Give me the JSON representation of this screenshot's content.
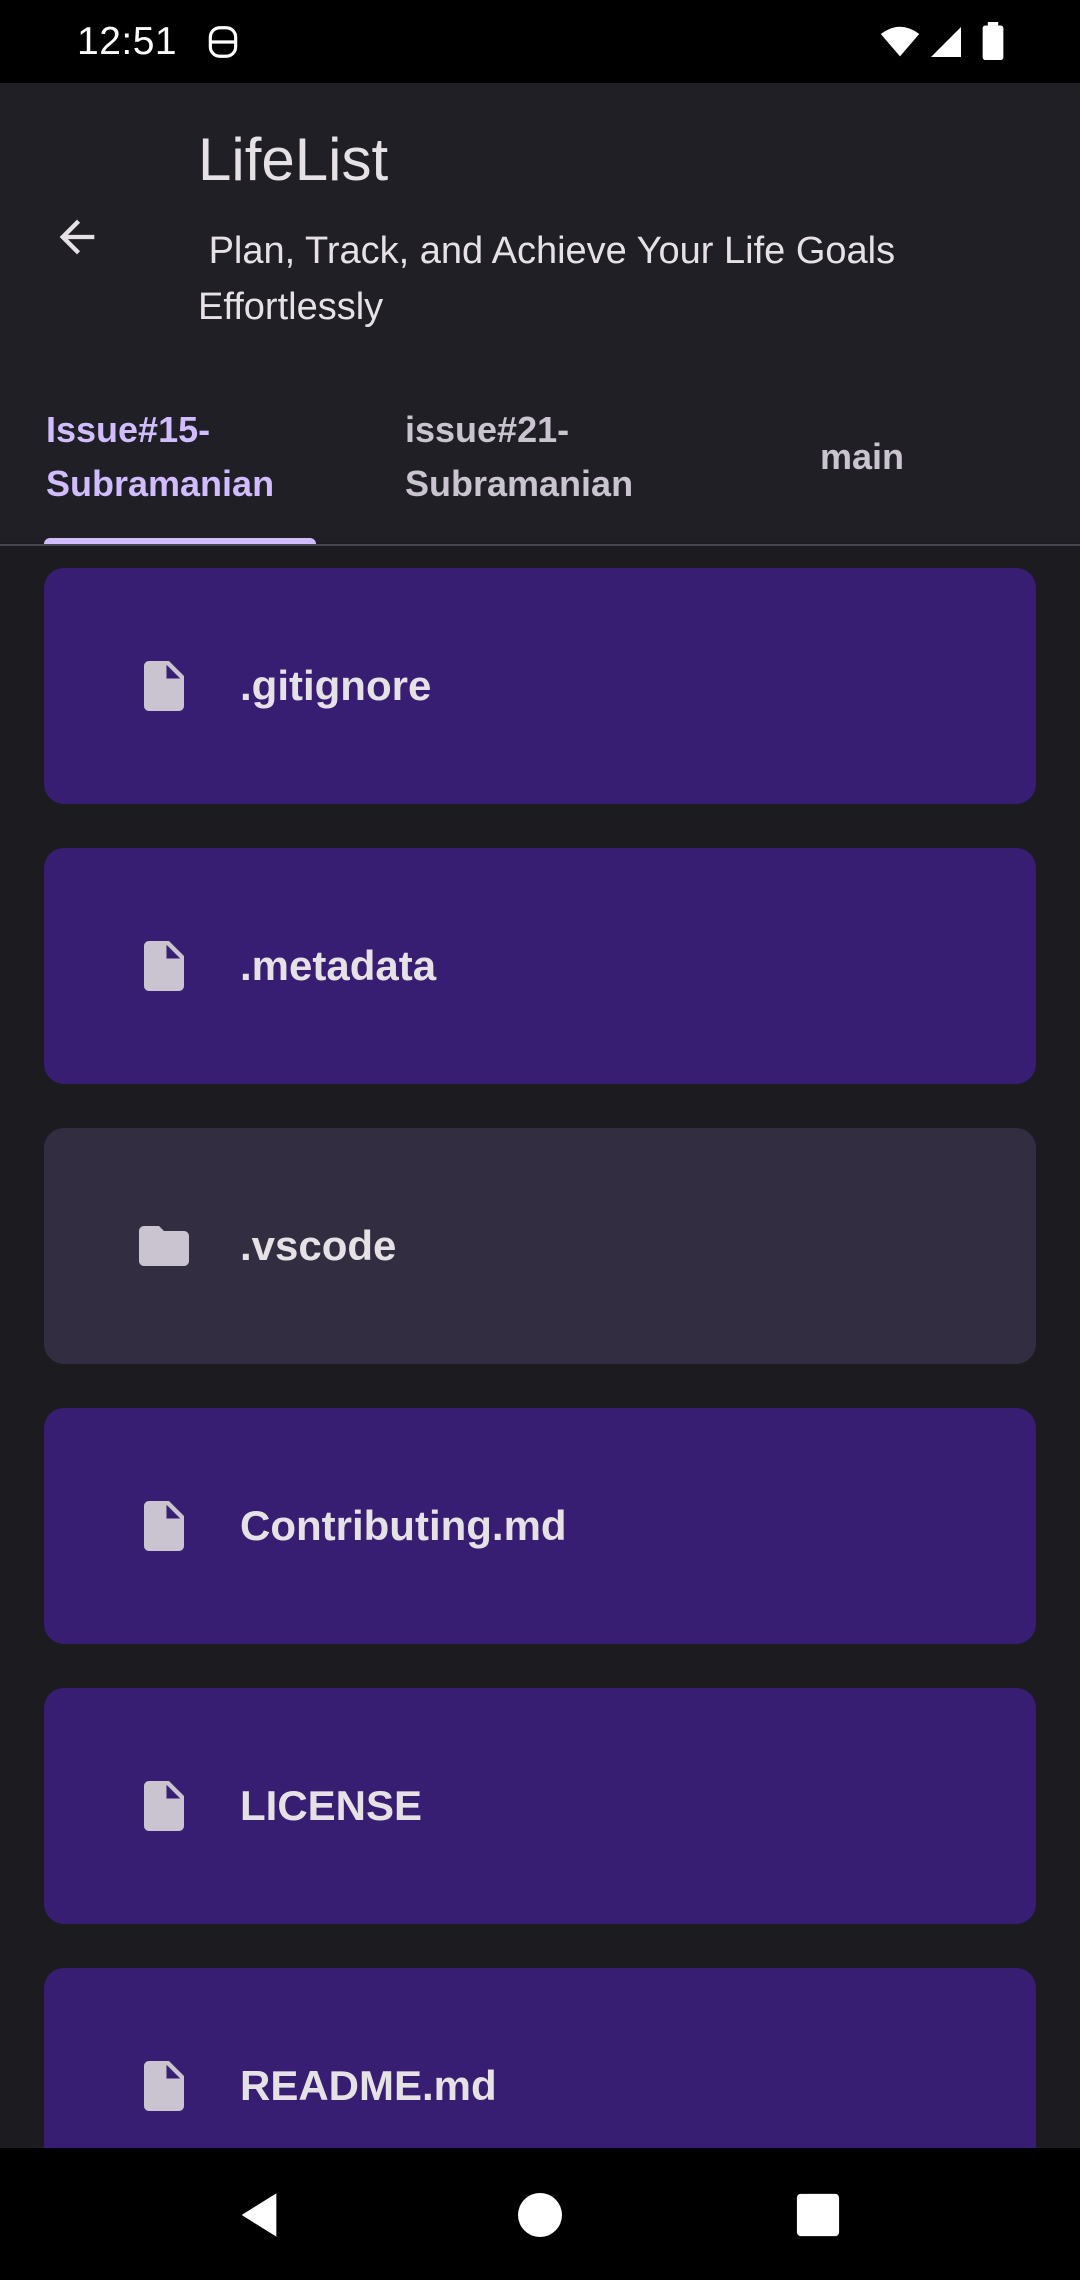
{
  "status_bar": {
    "time": "12:51",
    "icons": [
      "app-notification-icon",
      "wifi-icon",
      "signal-icon",
      "battery-icon"
    ]
  },
  "header": {
    "title": "LifeList",
    "subtitle": " Plan, Track, and Achieve Your Life Goals\nEffortlessly",
    "back_icon": "arrow-back-icon"
  },
  "tabs": [
    {
      "label": "Issue#15-\nSubramanian",
      "selected": true
    },
    {
      "label": "issue#21-\nSubramanian",
      "selected": false
    },
    {
      "label": "main",
      "selected": false
    }
  ],
  "files": [
    {
      "name": ".gitignore",
      "type": "file",
      "icon": "file-icon"
    },
    {
      "name": ".metadata",
      "type": "file",
      "icon": "file-icon"
    },
    {
      "name": ".vscode",
      "type": "folder",
      "icon": "folder-icon"
    },
    {
      "name": "Contributing.md",
      "type": "file",
      "icon": "file-icon"
    },
    {
      "name": "LICENSE",
      "type": "file",
      "icon": "file-icon"
    },
    {
      "name": "README.md",
      "type": "file",
      "icon": "file-icon"
    }
  ],
  "nav_bar": {
    "buttons": [
      "back-triangle-icon",
      "home-circle-icon",
      "recents-square-icon"
    ]
  },
  "colors": {
    "background": "#1c1b20",
    "app_bar": "#211f26",
    "accent": "#d0bcff",
    "file_card": "#381e72",
    "folder_card": "#332d41",
    "icon_tint": "#cac4d0"
  }
}
